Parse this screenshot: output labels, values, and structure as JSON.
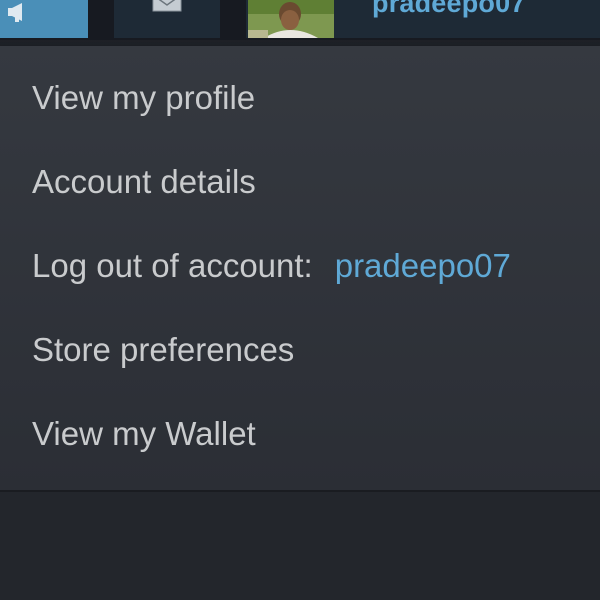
{
  "topbar": {
    "announcements_icon": "megaphone-icon",
    "inbox_icon": "envelope-icon",
    "avatar_icon": "user-avatar",
    "username": "pradeepo07",
    "colors": {
      "bar": "#171a21",
      "announce_button": "#4a8fb8",
      "button": "#1e2a36",
      "username": "#5fa9d6"
    }
  },
  "menu": {
    "items": [
      {
        "label": "View my profile"
      },
      {
        "label": "Account details"
      },
      {
        "label": "Log out of account:",
        "account": "pradeepo07"
      },
      {
        "label": "Store preferences"
      },
      {
        "label": "View my Wallet"
      }
    ],
    "colors": {
      "background": "#33373e",
      "text": "#c9cbcd",
      "accent": "#5fa9d6"
    }
  }
}
